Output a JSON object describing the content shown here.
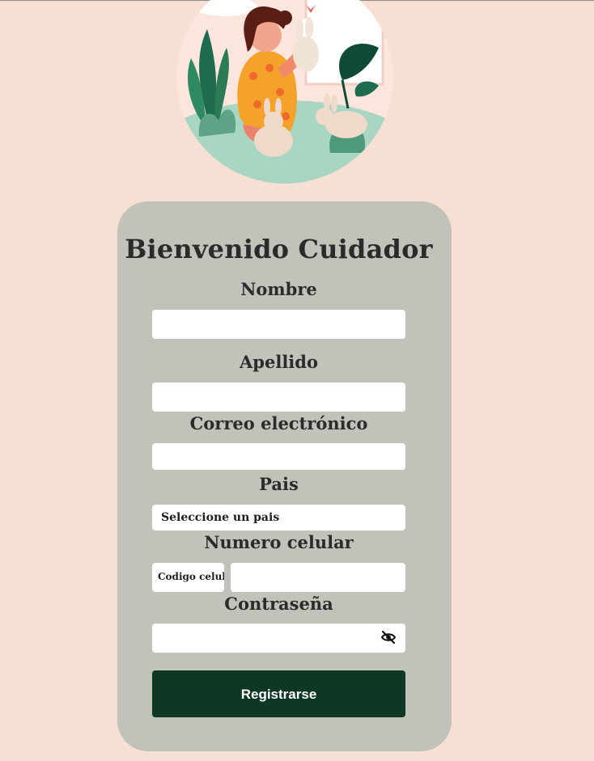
{
  "form": {
    "title": "Bienvenido Cuidador",
    "labels": {
      "nombre": "Nombre",
      "apellido": "Apellido",
      "correo": "Correo electrónico",
      "pais": "Pais",
      "celular": "Numero celular",
      "password": "Contraseña"
    },
    "values": {
      "nombre": "",
      "apellido": "",
      "correo": "",
      "celular": "",
      "password": ""
    },
    "country_select": {
      "selected": "Seleccione un pais"
    },
    "phone_code": {
      "selected": "Codigo celul"
    },
    "submit_label": "Registrarse"
  },
  "icons": {
    "password_toggle": "eye-slash-icon",
    "hero": "woman-with-rabbits-illustration"
  },
  "colors": {
    "page_background": "#f6e0d4",
    "card_background": "#c1c2ba",
    "button_background": "#0e3824",
    "text": "#2b2b2b"
  }
}
